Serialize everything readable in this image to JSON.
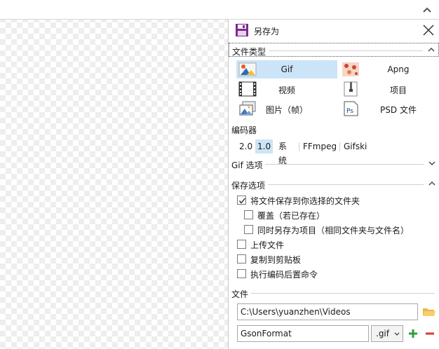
{
  "panel": {
    "title": "另存为"
  },
  "file_type_section": {
    "label": "文件类型",
    "items": [
      {
        "label": "Gif",
        "icon": "gif-icon",
        "selected": true
      },
      {
        "label": "Apng",
        "icon": "apng-icon",
        "selected": false
      },
      {
        "label": "视频",
        "icon": "video-film-icon",
        "selected": false
      },
      {
        "label": "项目",
        "icon": "project-zip-icon",
        "selected": false
      },
      {
        "label": "图片（帧）",
        "icon": "image-frames-icon",
        "selected": false
      },
      {
        "label": "PSD 文件",
        "icon": "photoshop-icon",
        "selected": false
      }
    ]
  },
  "encoder_section": {
    "label": "编码器",
    "tabs": [
      {
        "label": "2.0",
        "active": false
      },
      {
        "label": "1.0",
        "active": true
      },
      {
        "label": "系统",
        "active": false
      },
      {
        "label": "FFmpeg",
        "active": false
      },
      {
        "label": "Gifski",
        "active": false
      }
    ]
  },
  "gif_options_section": {
    "label": "Gif 选项",
    "expanded": false
  },
  "save_options_section": {
    "label": "保存选项",
    "expanded": true,
    "options": [
      {
        "label": "将文件保存到你选择的文件夹",
        "checked": true
      },
      {
        "label": "覆盖（若已存在）",
        "checked": false
      },
      {
        "label": "同时另存为项目（相同文件夹与文件名）",
        "checked": false
      },
      {
        "label": "上传文件",
        "checked": false
      },
      {
        "label": "复制到剪贴板",
        "checked": false
      },
      {
        "label": "执行编码后置命令",
        "checked": false
      }
    ]
  },
  "file_section": {
    "label": "文件",
    "folder_path": "C:\\Users\\yuanzhen\\Videos",
    "file_name": "GsonFormat",
    "extension": ".gif"
  },
  "colors": {
    "selection": "#cce4f7",
    "save_icon": "#7b2a8e",
    "add": "#2e9e3e",
    "remove": "#d93a3a",
    "folder": "#e8b84a"
  }
}
